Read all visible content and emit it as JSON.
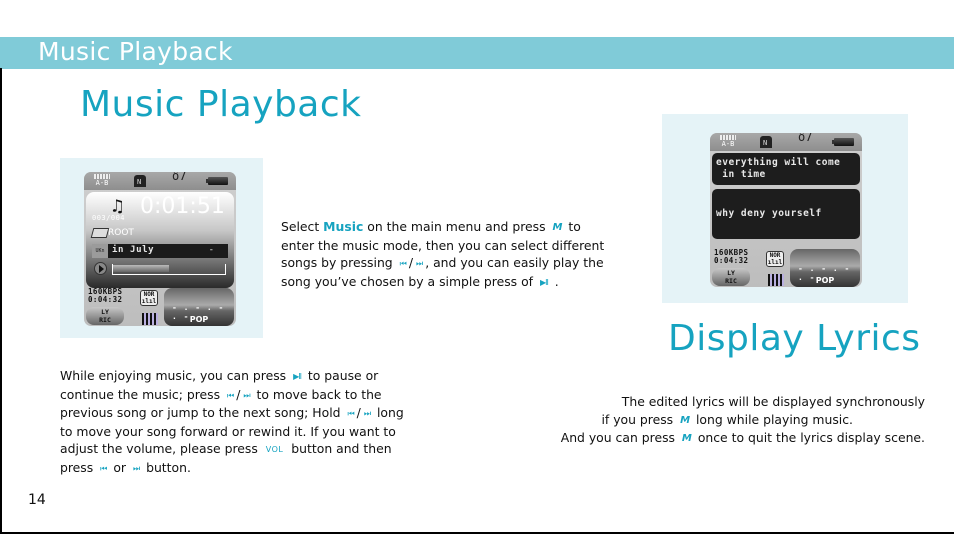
{
  "header": {
    "title": "Music Playback",
    "color": "#80cbd8"
  },
  "main_title": "Music Playback",
  "lyrics_title": "Display Lyrics",
  "accent_color": "#16a3c0",
  "page_number": "14",
  "icons": {
    "menu": "M",
    "prev": "⏮",
    "next": "⏭",
    "play_pause": "▶II",
    "vol": "VOL",
    "slash": "/"
  },
  "player_screen": {
    "status_ab": "A-B",
    "track_counter": "003/004",
    "elapsed_time": "0:01:51",
    "folder": "ROOT",
    "song_title": "in July",
    "song_suffix": "-",
    "eq_badge": "UKn",
    "progress_fraction": 0.5,
    "bitrate": "160KBPS",
    "total_time": "0:04:32",
    "lyric_button": [
      "LY",
      "RIC"
    ],
    "mode": "NOR",
    "eq_name": "POP",
    "eq_dots": "- . - . - . -"
  },
  "lyrics_screen": {
    "status_ab": "A-B",
    "lyric_line_1": "everything will come\n in time",
    "lyric_line_2": "why deny yourself",
    "bitrate": "160KBPS",
    "total_time": "0:04:32",
    "lyric_button": [
      "LY",
      "RIC"
    ],
    "mode": "NOR",
    "eq_name": "POP",
    "eq_dots": "- . - . - . -"
  },
  "select_text": {
    "p1": "Select ",
    "keyword": "Music",
    "p2": " on the main menu and press ",
    "p3": " to enter the music mode, then you can select different songs by pressing ",
    "p4": ", and you can easily play the song you’ve chosen by a simple press of ",
    "p5": " ."
  },
  "play_text": {
    "p1": "While enjoying music, you can press ",
    "p2": " to pause or continue the music; press ",
    "p3": " to move back to the previous song or jump to the next song; Hold ",
    "p4": " long to move your song forward or rewind it. If you want to adjust the volume, please press ",
    "p5": " button and then press ",
    "p6": " or ",
    "p7": " button."
  },
  "lyrics_text": {
    "line1": "The edited lyrics will be displayed synchronously",
    "line2_a": "if you press ",
    "line2_b": " long while playing music.",
    "line3_a": "And you can press ",
    "line3_b": " once to quit the lyrics display scene."
  }
}
